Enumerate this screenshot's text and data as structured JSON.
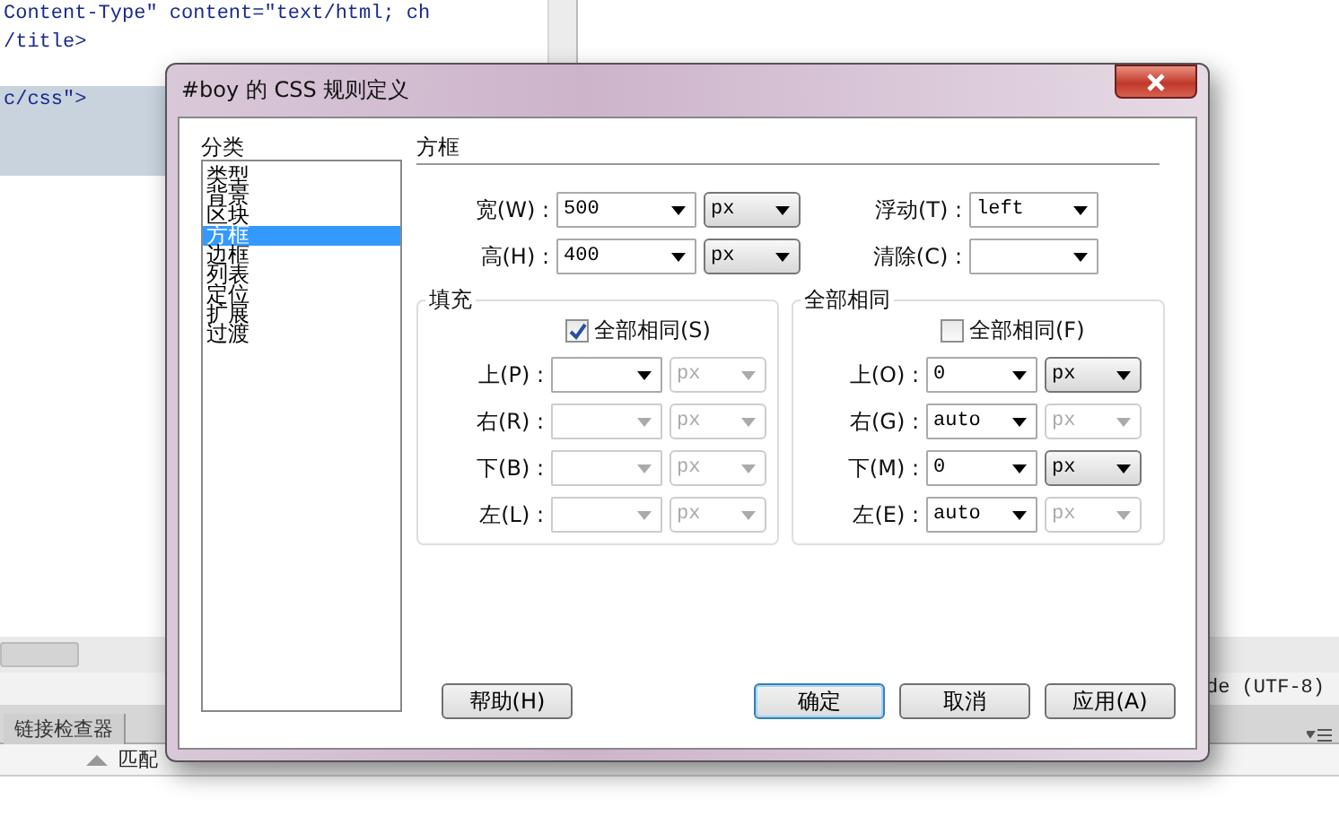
{
  "editor": {
    "code_lines": [
      "Content-Type\" content=\"text/html; ch",
      "/title>",
      "c/css\">"
    ],
    "scroll_label": "de (UTF-8)",
    "panel_tabs": [
      "链接检查器"
    ],
    "bottom_text": "匹配"
  },
  "dialog": {
    "title": "#boy 的 CSS 规则定义",
    "category_label": "分类",
    "categories": [
      {
        "label": "类型",
        "selected": false
      },
      {
        "label": "背景",
        "selected": false
      },
      {
        "label": "区块",
        "selected": false
      },
      {
        "label": "方框",
        "selected": true
      },
      {
        "label": "边框",
        "selected": false
      },
      {
        "label": "列表",
        "selected": false
      },
      {
        "label": "定位",
        "selected": false
      },
      {
        "label": "扩展",
        "selected": false
      },
      {
        "label": "过渡",
        "selected": false
      }
    ],
    "section_title": "方框",
    "size_fields": [
      {
        "label": "宽(W) :",
        "value": "500",
        "unit": "px"
      },
      {
        "label": "高(H) :",
        "value": "400",
        "unit": "px"
      }
    ],
    "float_fields": [
      {
        "label": "浮动(T) :",
        "value": "left"
      },
      {
        "label": "清除(C) :"
      }
    ],
    "groups": [
      {
        "title": "填充",
        "same_all": {
          "label": "全部相同(S)",
          "checked": true
        },
        "rows": [
          {
            "label": "上(P) :",
            "unit": "px",
            "disabled": false,
            "unit_disabled": true
          },
          {
            "label": "右(R) :",
            "unit": "px",
            "disabled": true,
            "unit_disabled": true
          },
          {
            "label": "下(B) :",
            "unit": "px",
            "disabled": true,
            "unit_disabled": true
          },
          {
            "label": "左(L) :",
            "unit": "px",
            "disabled": true,
            "unit_disabled": true
          }
        ]
      },
      {
        "title": "全部相同",
        "same_all": {
          "label": "全部相同(F)",
          "checked": false
        },
        "rows": [
          {
            "label": "上(O) :",
            "value": "0",
            "unit": "px",
            "disabled": false,
            "unit_disabled": false
          },
          {
            "label": "右(G) :",
            "value": "auto",
            "unit": "px",
            "disabled": false,
            "unit_disabled": true
          },
          {
            "label": "下(M) :",
            "value": "0",
            "unit": "px",
            "disabled": false,
            "unit_disabled": false
          },
          {
            "label": "左(E) :",
            "value": "auto",
            "unit": "px",
            "disabled": false,
            "unit_disabled": true
          }
        ]
      }
    ],
    "buttons": [
      {
        "label": "帮助(H)",
        "default": false,
        "kind": "help"
      },
      {
        "label": "确定",
        "default": true,
        "kind": "action"
      },
      {
        "label": "取消",
        "default": false,
        "kind": "action"
      },
      {
        "label": "应用(A)",
        "default": false,
        "kind": "action"
      }
    ]
  }
}
